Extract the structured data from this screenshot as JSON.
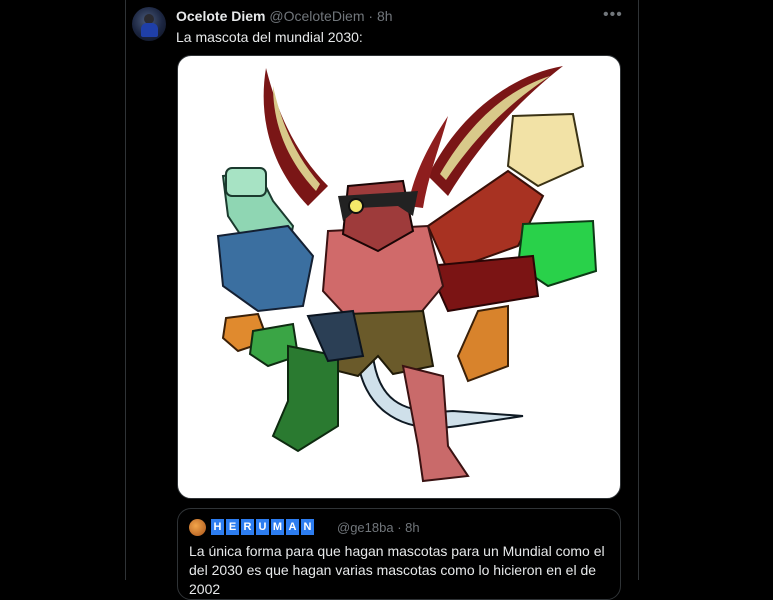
{
  "tweet": {
    "author_name": "Ocelote Diem",
    "author_handle": "@OceloteDiem",
    "separator": "·",
    "time": "8h",
    "more_label": "•••",
    "text": "La mascota del mundial 2030:"
  },
  "quote": {
    "author_name_letters": [
      "H",
      "E",
      "R",
      "U",
      "M",
      "A",
      "N"
    ],
    "author_handle": "@ge18ba",
    "separator": "·",
    "time": "8h",
    "text": "La única forma para que hagan mascotas para un Mundial como el del 2030 es que hagan varias mascotas como lo hicieron en el de 2002"
  },
  "colors": {
    "background": "#000000",
    "text": "#e7e9ea",
    "muted": "#71767b",
    "border": "#2f3336",
    "name_badge": "#2d7df0"
  },
  "icons": {
    "more": "more-horizontal-icon"
  }
}
